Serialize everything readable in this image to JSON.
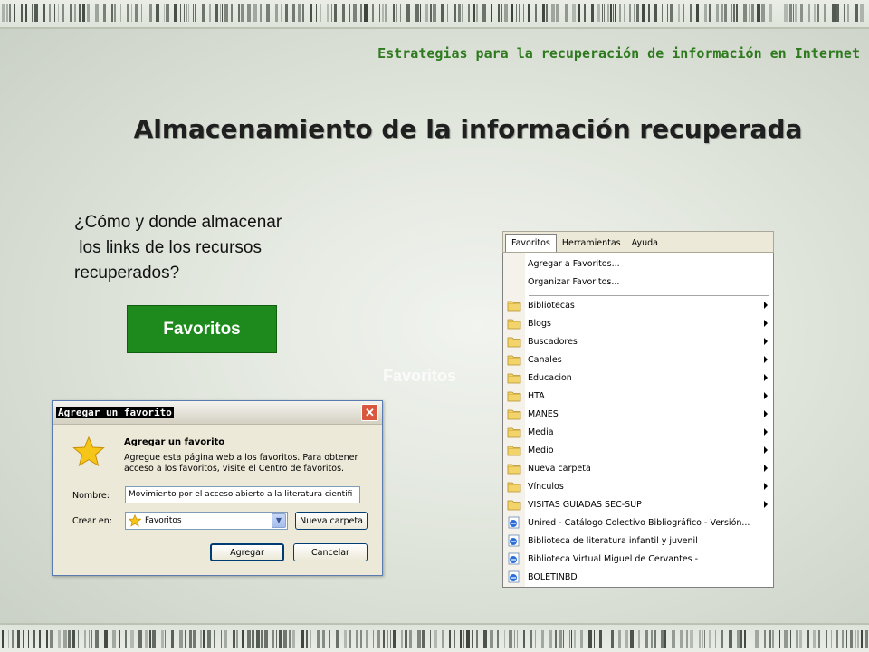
{
  "subtitle": "Estrategias para la recuperación de información en Internet",
  "title": "Almacenamiento de la información recuperada",
  "question": {
    "line1": "¿Cómo y donde almacenar",
    "line2": " los links de los recursos",
    "line3": "recuperados?"
  },
  "favorites_button": "Favoritos",
  "faded_label": "Favoritos",
  "dialog": {
    "title": "Agregar un favorito",
    "close_glyph": "✕",
    "heading": "Agregar un favorito",
    "description": "Agregue esta página web a los favoritos. Para obtener acceso a los favoritos, visite el Centro de favoritos.",
    "name_label": "Nombre:",
    "name_value": "Movimiento por el acceso abierto a la literatura cientifi",
    "create_label": "Crear en:",
    "create_value": "Favoritos",
    "new_folder_button": "Nueva carpeta",
    "add_button": "Agregar",
    "cancel_button": "Cancelar"
  },
  "menubar": {
    "items": [
      "Favoritos",
      "Herramientas",
      "Ayuda"
    ]
  },
  "menu": {
    "actions": [
      "Agregar a Favoritos...",
      "Organizar Favoritos..."
    ],
    "folders": [
      "Bibliotecas",
      "Blogs",
      "Buscadores",
      "Canales",
      "Educacion",
      "HTA",
      "MANES",
      "Media",
      "Medio",
      "Nueva carpeta",
      "Vínculos",
      "VISITAS GUIADAS SEC-SUP"
    ],
    "links": [
      "Unired - Catálogo Colectivo Bibliográfico - Versión...",
      "Biblioteca de literatura infantil y juvenil",
      "Biblioteca Virtual Miguel de Cervantes -",
      "BOLETINBD"
    ]
  },
  "colors": {
    "accent_green": "#1e8a1e",
    "subtitle_green": "#2f7a1f",
    "folder_yellow": "#f2d46b",
    "dialog_bg": "#ece9d8"
  },
  "icons": {
    "folder": "folder-icon",
    "link": "ie-page-icon",
    "star": "star-icon",
    "submenu": "chevron-right-icon"
  }
}
